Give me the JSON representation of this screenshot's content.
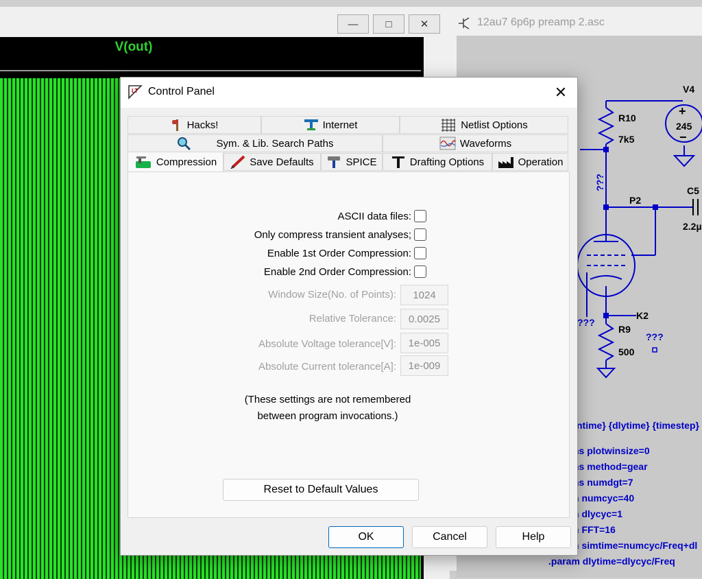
{
  "waveform": {
    "plot_title": "V(out)",
    "buttons": {
      "minimize": "—",
      "maximize": "□",
      "close": "✕"
    }
  },
  "schematic": {
    "title": "12au7 6p6p preamp 2.asc",
    "components": {
      "r10_name": "R10",
      "r10_value": "7k5",
      "v4_name": "V4",
      "v4_value": "245",
      "c5_name": "C5",
      "c5_value": "2.2µ",
      "p2": "P2",
      "k2": "K2",
      "r9_name": "R9",
      "r9_value": "500",
      "unknown": "???"
    },
    "directives": [
      "ntime} {dlytime} {timestep}",
      "ns plotwinsize=0",
      "ns method=gear",
      "ns numdgt=7",
      "n numcyc=40",
      "n dlycyc=1",
      "n FFT=16",
      "n simtime=numcyc/Freq+dl",
      ".param dlytime=dlycyc/Freq"
    ]
  },
  "dialog": {
    "title": "Control Panel",
    "close": "✕",
    "tabs": {
      "hacks": "Hacks!",
      "internet": "Internet",
      "netlist": "Netlist Options",
      "sym_lib": "Sym. & Lib. Search Paths",
      "waveforms": "Waveforms",
      "compression": "Compression",
      "save_defaults": "Save Defaults",
      "spice": "SPICE",
      "drafting": "Drafting Options",
      "operation": "Operation"
    },
    "checkboxes": [
      {
        "label": "ASCII data files:"
      },
      {
        "label": "Only compress transient analyses;"
      },
      {
        "label": "Enable 1st Order Compression:"
      },
      {
        "label": "Enable 2nd Order Compression:"
      }
    ],
    "fields": [
      {
        "label": "Window Size(No. of Points):",
        "value": "1024"
      },
      {
        "label": "Relative Tolerance:",
        "value": "0.0025"
      },
      {
        "label": "Absolute Voltage tolerance[V]:",
        "value": "1e-005"
      },
      {
        "label": "Absolute Current tolerance[A]:",
        "value": "1e-009"
      }
    ],
    "note_line1": "(These settings are not remembered",
    "note_line2": "between program invocations.)",
    "reset_button": "Reset to Default Values",
    "ok_button": "OK",
    "cancel_button": "Cancel",
    "help_button": "Help"
  }
}
